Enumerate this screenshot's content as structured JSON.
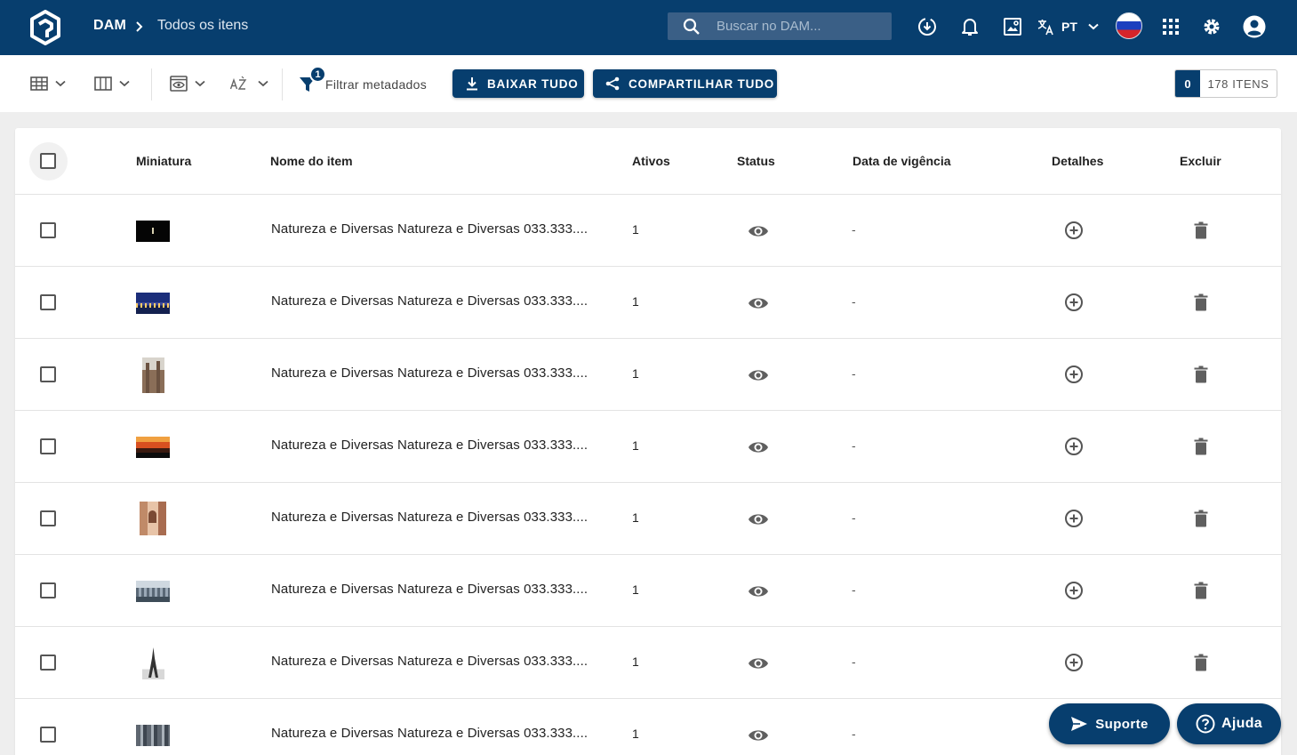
{
  "app": {
    "breadcrumb_root": "DAM",
    "breadcrumb_current": "Todos os itens",
    "search_placeholder": "Buscar no DAM...",
    "language_code": "PT",
    "colors": {
      "primary": "#073e6e",
      "search_bg": "#3a5f86",
      "background": "#eeeeee"
    },
    "icons": [
      "logo-icon",
      "search-icon",
      "download-center-icon",
      "bell-icon",
      "image-search-icon",
      "translate-icon",
      "flag-icon",
      "apps-grid-icon",
      "gear-icon",
      "account-icon"
    ]
  },
  "toolbar": {
    "filter_count": "1",
    "filter_label": "Filtrar metadados",
    "download_all_label": "BAIXAR TUDO",
    "share_all_label": "COMPARTILHAR TUDO",
    "selected_count": "0",
    "total_items_label": "178 ITENS"
  },
  "table": {
    "columns": {
      "thumbnail": "Miniatura",
      "name": "Nome do item",
      "assets": "Ativos",
      "status": "Status",
      "validity": "Data de vigência",
      "details": "Detalhes",
      "delete": "Excluir"
    },
    "rows": [
      {
        "name": "Natureza e Diversas Natureza e Diversas 033.333....",
        "assets": "1",
        "validity": "-",
        "thumb": "night"
      },
      {
        "name": "Natureza e Diversas Natureza e Diversas 033.333....",
        "assets": "1",
        "validity": "-",
        "thumb": "city-night"
      },
      {
        "name": "Natureza e Diversas Natureza e Diversas 033.333....",
        "assets": "1",
        "validity": "-",
        "thumb": "church"
      },
      {
        "name": "Natureza e Diversas Natureza e Diversas 033.333....",
        "assets": "1",
        "validity": "-",
        "thumb": "sunset"
      },
      {
        "name": "Natureza e Diversas Natureza e Diversas 033.333....",
        "assets": "1",
        "validity": "-",
        "thumb": "building"
      },
      {
        "name": "Natureza e Diversas Natureza e Diversas 033.333....",
        "assets": "1",
        "validity": "-",
        "thumb": "skyline"
      },
      {
        "name": "Natureza e Diversas Natureza e Diversas 033.333....",
        "assets": "1",
        "validity": "-",
        "thumb": "eiffel"
      },
      {
        "name": "Natureza e Diversas Natureza e Diversas 033.333....",
        "assets": "1",
        "validity": "-",
        "thumb": "towers"
      }
    ]
  },
  "fabs": {
    "support_label": "Suporte",
    "help_label": "Ajuda"
  }
}
